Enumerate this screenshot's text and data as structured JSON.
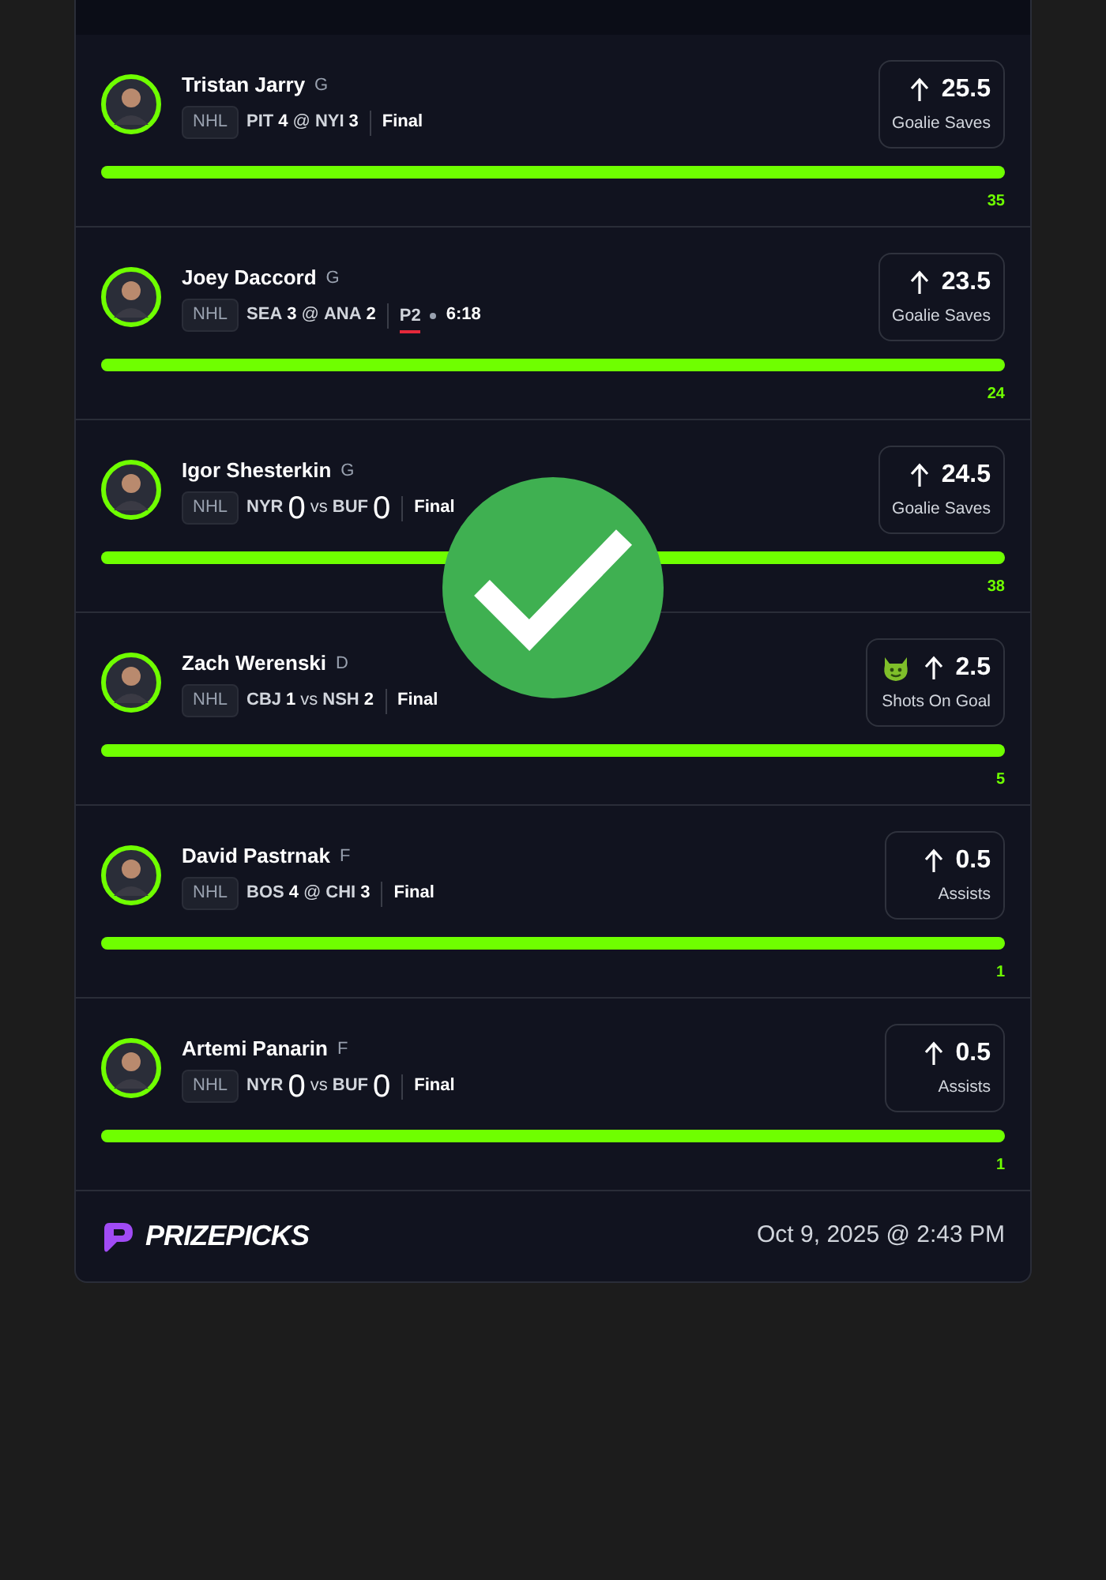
{
  "picks": [
    {
      "name": "Tristan Jarry",
      "position": "G",
      "league": "NHL",
      "away_team": "PIT",
      "away_score": "4",
      "separator": "@",
      "home_team": "NYI",
      "home_score": "3",
      "large_scores": false,
      "status": {
        "kind": "final",
        "text": "Final"
      },
      "line": "25.5",
      "stat": "Goalie Saves",
      "boost": false,
      "level": 1,
      "result": "35"
    },
    {
      "name": "Joey Daccord",
      "position": "G",
      "league": "NHL",
      "away_team": "SEA",
      "away_score": "3",
      "separator": "@",
      "home_team": "ANA",
      "home_score": "2",
      "large_scores": false,
      "status": {
        "kind": "live",
        "period": "P2",
        "clock": "6:18"
      },
      "line": "23.5",
      "stat": "Goalie Saves",
      "boost": false,
      "level": 1,
      "result": "24"
    },
    {
      "name": "Igor Shesterkin",
      "position": "G",
      "league": "NHL",
      "away_team": "NYR",
      "away_score": "0",
      "separator": "vs",
      "home_team": "BUF",
      "home_score": "0",
      "large_scores": true,
      "status": {
        "kind": "final",
        "text": "Final"
      },
      "line": "24.5",
      "stat": "Goalie Saves",
      "boost": false,
      "level": 1,
      "result": "38"
    },
    {
      "name": "Zach Werenski",
      "position": "D",
      "league": "NHL",
      "away_team": "CBJ",
      "away_score": "1",
      "separator": "vs",
      "home_team": "NSH",
      "home_score": "2",
      "large_scores": false,
      "status": {
        "kind": "final",
        "text": "Final"
      },
      "line": "2.5",
      "stat": "Shots On Goal",
      "boost": true,
      "level": 1,
      "result": "5"
    },
    {
      "name": "David Pastrnak",
      "position": "F",
      "league": "NHL",
      "away_team": "BOS",
      "away_score": "4",
      "separator": "@",
      "home_team": "CHI",
      "home_score": "3",
      "large_scores": false,
      "status": {
        "kind": "final",
        "text": "Final"
      },
      "line": "0.5",
      "stat": "Assists",
      "boost": false,
      "level": 1,
      "result": "1"
    },
    {
      "name": "Artemi Panarin",
      "position": "F",
      "league": "NHL",
      "away_team": "NYR",
      "away_score": "0",
      "separator": "vs",
      "home_team": "BUF",
      "home_score": "0",
      "large_scores": true,
      "status": {
        "kind": "final",
        "text": "Final"
      },
      "line": "0.5",
      "stat": "Assists",
      "boost": false,
      "level": 1,
      "result": "1"
    }
  ],
  "footer": {
    "brand": "PRIZEPICKS",
    "timestamp": "Oct 9, 2025 @ 2:43 PM"
  },
  "overlay": {
    "won": true
  }
}
